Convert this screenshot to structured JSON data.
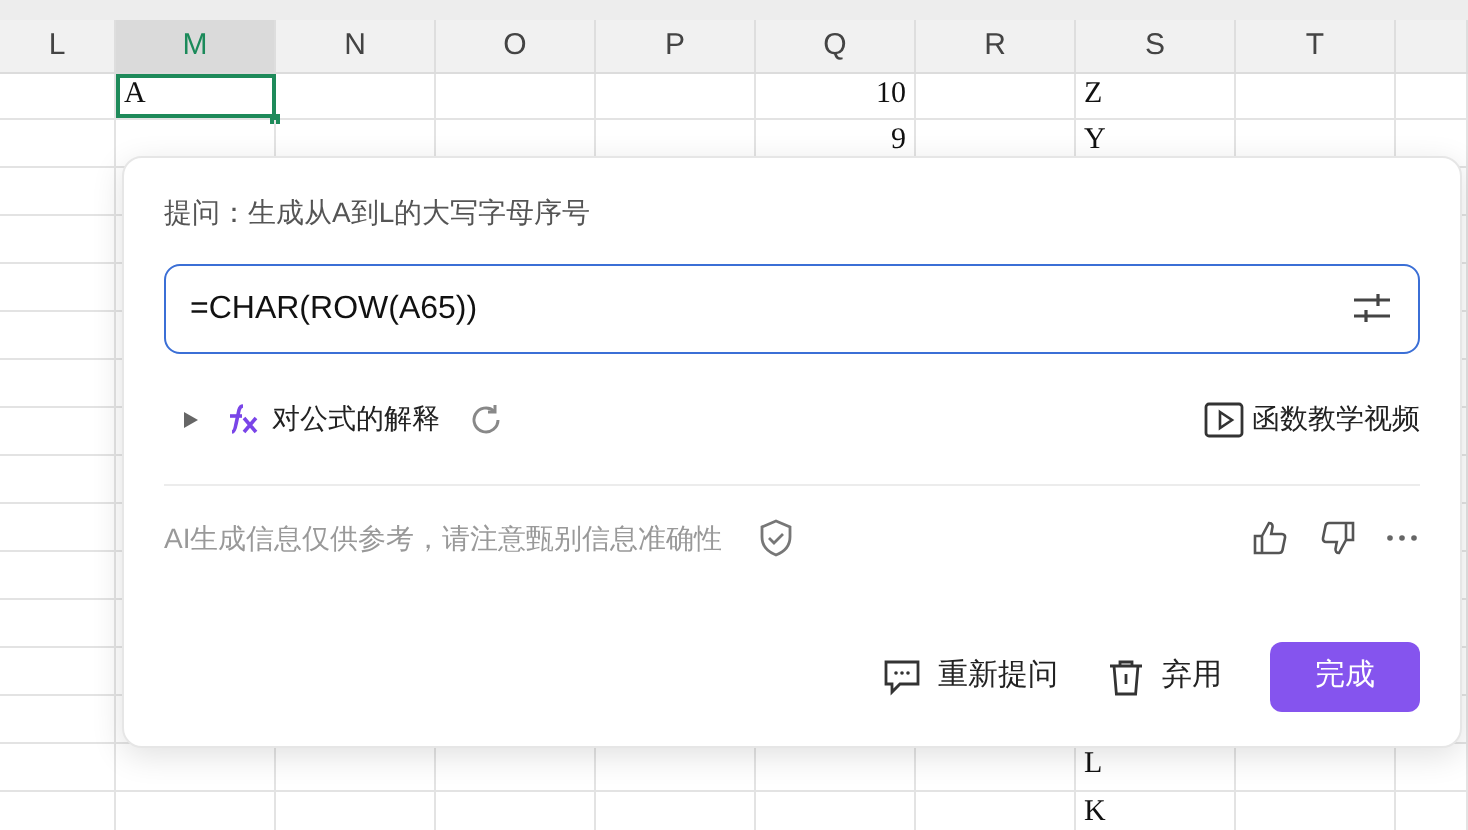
{
  "sheet": {
    "columns": [
      {
        "label": "L",
        "selected": false
      },
      {
        "label": "M",
        "selected": true
      },
      {
        "label": "N",
        "selected": false
      },
      {
        "label": "O",
        "selected": false
      },
      {
        "label": "P",
        "selected": false
      },
      {
        "label": "Q",
        "selected": false
      },
      {
        "label": "R",
        "selected": false
      },
      {
        "label": "S",
        "selected": false
      },
      {
        "label": "T",
        "selected": false
      }
    ],
    "rows": [
      {
        "cells": [
          null,
          {
            "text": "A",
            "kind": "text",
            "selected": true
          },
          null,
          null,
          null,
          {
            "text": "10",
            "kind": "number",
            "selected": false
          },
          null,
          {
            "text": "Z",
            "kind": "text",
            "selected": false
          },
          null
        ]
      },
      {
        "cells": [
          null,
          null,
          null,
          null,
          null,
          {
            "text": "9",
            "kind": "number",
            "selected": false
          },
          null,
          {
            "text": "Y",
            "kind": "text",
            "selected": false
          },
          null
        ]
      },
      {},
      {},
      {},
      {},
      {},
      {},
      {},
      {},
      {},
      {},
      {},
      {},
      {
        "cells": [
          null,
          null,
          null,
          null,
          null,
          null,
          null,
          {
            "text": "L",
            "kind": "text",
            "selected": false
          },
          null
        ]
      },
      {
        "cells": [
          null,
          null,
          null,
          null,
          null,
          null,
          null,
          {
            "text": "K",
            "kind": "text",
            "selected": false
          },
          null
        ]
      }
    ]
  },
  "assistant": {
    "prompt": "提问：生成从A到L的大写字母序号",
    "formula": {
      "value": "=CHAR(ROW(A65))"
    },
    "explanation": {
      "label": "对公式的解释",
      "expanded": false
    },
    "video_link": "函数教学视频",
    "disclaimer": "AI生成信息仅供参考，请注意甄别信息准确性",
    "buttons": [
      {
        "label": "重新提问",
        "kind": "retry"
      },
      {
        "label": "弃用",
        "kind": "discard"
      },
      {
        "label": "完成",
        "kind": "primary"
      }
    ]
  }
}
